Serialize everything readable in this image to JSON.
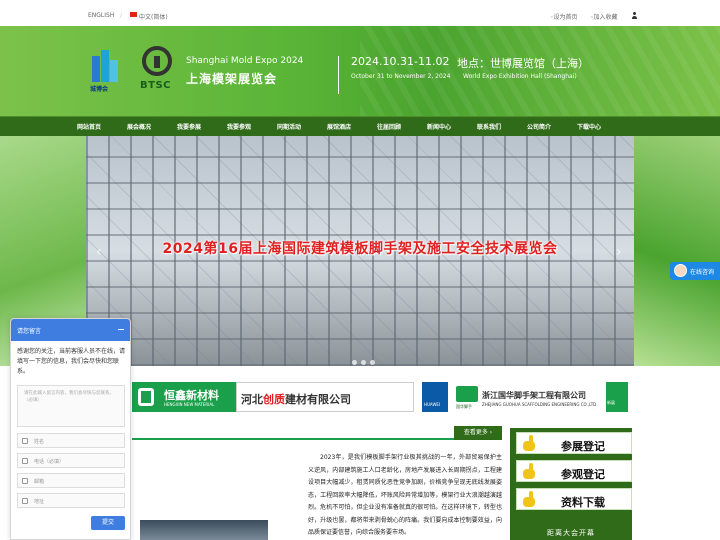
{
  "topbar": {
    "lang_en": "ENGLISH",
    "lang_cn": "中文(简体)",
    "set_home": "设为首页",
    "add_fav": "加入收藏"
  },
  "banner": {
    "logo1_text": "城博会",
    "logo2_text": "BTSC",
    "title_en": "Shanghai  Mold Expo 2024",
    "title_cn": "上海模架展览会",
    "date": "2024.10.31-11.02",
    "place": "地点：世博展览馆（上海）",
    "date_en": "October 31 to November 2, 2024",
    "place_en": "World Expo Exhibition Hall (Shanghai)"
  },
  "nav": {
    "items": [
      "网站首页",
      "展会概况",
      "我要参展",
      "我要参观",
      "同期活动",
      "展馆酒店",
      "往届回顾",
      "新闻中心",
      "联系我们",
      "公司简介",
      "下载中心"
    ]
  },
  "slider": {
    "headline": "2024第16届上海国际建筑模板脚手架及施工安全技术展览会"
  },
  "online": {
    "label": "在线咨询"
  },
  "sponsors": {
    "s1_name": "恒鑫新材料",
    "s1_en": "HENGXIN NEW MATERIAL",
    "s2_prefix": "河北",
    "s2_brand": "创质",
    "s2_suffix": "建材有限公司",
    "s3_text": "HUAWEI",
    "s4_mark": "国华脚手",
    "s4_name": "浙江国华脚手架工程有限公司",
    "s4_en": "ZHEJIANG GUOHUA SCAFFOLDING ENGINEERING CO.,LTD",
    "s5_text": "新展"
  },
  "section": {
    "more": "查看更多 ›"
  },
  "article": {
    "text": "2023年，是我们模板脚手架行业极其挑战的一年，外部贸易保护主义逆风，内部建筑施工人口老龄化，房地产发展进入长周期拐点，工程建设项目大幅减少，租赁同质化恶性竞争加剧，价格竞争呈现无底线发展姿态，工程回款率大幅降低，坏账风险异常增加等，模架行业大浪潮越演越烈。危机不可怕，但企业没有准备就真的很可怕。在这样环境下，转型也好，升级也罢，都将带来剥骨蜕心的阵痛。我们要向成本控制要效益，向品质保证要信誉，向综合服务要市场。"
  },
  "right_panel": {
    "buttons": [
      "参展登记",
      "参观登记",
      "资料下载"
    ],
    "footer": "距离大会开幕"
  },
  "chat": {
    "title": "请您留言",
    "intro": "感谢您的关注，当前客服人员不在线，请填写一下您的信息，我们会尽快和您联系。",
    "textarea_placeholder": "请在此输入留言内容，我们会尽快与您联系。（必填）",
    "fields": [
      "姓名",
      "电话（必填）",
      "邮箱",
      "地址"
    ],
    "submit": "提交"
  }
}
